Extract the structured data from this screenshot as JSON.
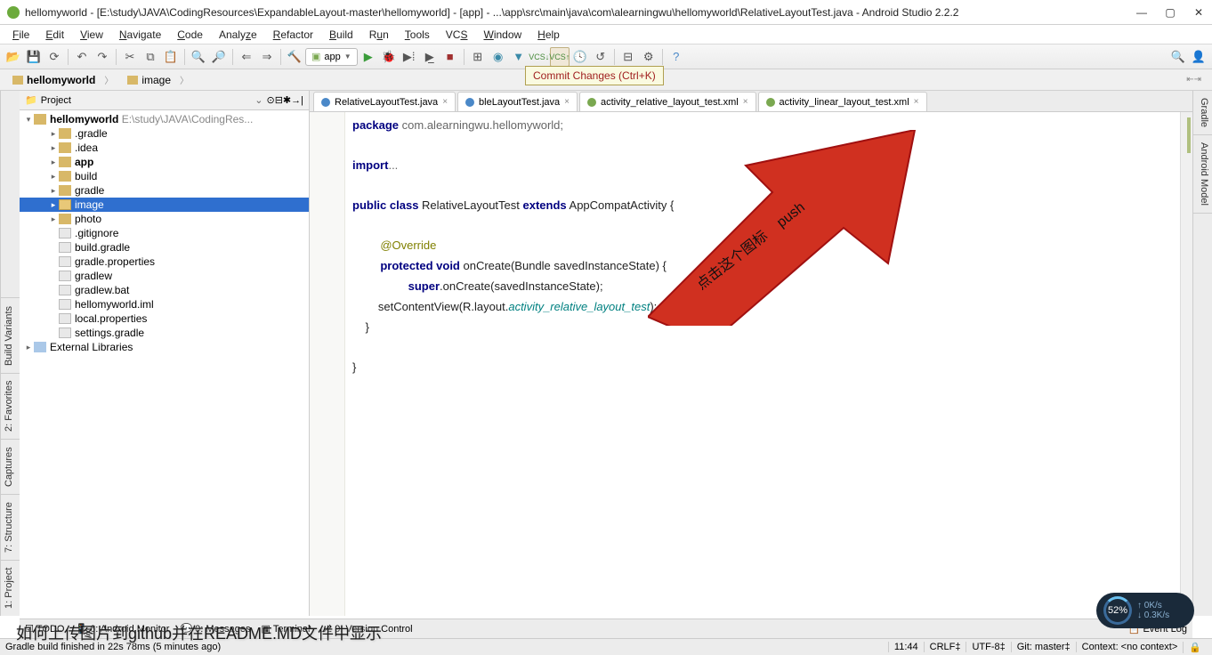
{
  "titlebar": {
    "title": "hellomyworld - [E:\\study\\JAVA\\CodingResources\\ExpandableLayout-master\\hellomyworld] - [app] - ...\\app\\src\\main\\java\\com\\alearningwu\\hellomyworld\\RelativeLayoutTest.java - Android Studio 2.2.2"
  },
  "menu": {
    "items": [
      "File",
      "Edit",
      "View",
      "Navigate",
      "Code",
      "Analyze",
      "Refactor",
      "Build",
      "Run",
      "Tools",
      "VCS",
      "Window",
      "Help"
    ]
  },
  "breadcrumbs": {
    "items": [
      "hellomyworld",
      "image"
    ]
  },
  "toolbar": {
    "config": "app",
    "tooltip": "Commit Changes (Ctrl+K)"
  },
  "leftRail": [
    "1: Project",
    "7: Structure",
    "Captures",
    "2: Favorites",
    "Build Variants"
  ],
  "rightRail": [
    "Gradle",
    "Android Model"
  ],
  "projectPanel": {
    "title": "Project"
  },
  "tree": {
    "root": {
      "label": "hellomyworld",
      "path": "E:\\study\\JAVA\\CodingRes..."
    },
    "items": [
      {
        "label": ".gradle",
        "depth": 1,
        "ico": "folder"
      },
      {
        "label": ".idea",
        "depth": 1,
        "ico": "folder"
      },
      {
        "label": "app",
        "depth": 1,
        "ico": "folder",
        "bold": true
      },
      {
        "label": "build",
        "depth": 1,
        "ico": "folder"
      },
      {
        "label": "gradle",
        "depth": 1,
        "ico": "folder"
      },
      {
        "label": "image",
        "depth": 1,
        "ico": "folder-o",
        "sel": true
      },
      {
        "label": "photo",
        "depth": 1,
        "ico": "folder"
      },
      {
        "label": ".gitignore",
        "depth": 1,
        "ico": "file"
      },
      {
        "label": "build.gradle",
        "depth": 1,
        "ico": "file"
      },
      {
        "label": "gradle.properties",
        "depth": 1,
        "ico": "file"
      },
      {
        "label": "gradlew",
        "depth": 1,
        "ico": "file"
      },
      {
        "label": "gradlew.bat",
        "depth": 1,
        "ico": "file"
      },
      {
        "label": "hellomyworld.iml",
        "depth": 1,
        "ico": "file"
      },
      {
        "label": "local.properties",
        "depth": 1,
        "ico": "file"
      },
      {
        "label": "settings.gradle",
        "depth": 1,
        "ico": "file"
      }
    ],
    "ext": "External Libraries"
  },
  "tabs": [
    {
      "label": "RelativeLayoutTest.java",
      "kind": "java"
    },
    {
      "label": "bleLayoutTest.java",
      "kind": "java"
    },
    {
      "label": "activity_relative_layout_test.xml",
      "kind": "xml"
    },
    {
      "label": "activity_linear_layout_test.xml",
      "kind": "xml"
    }
  ],
  "code": {
    "l1_kw": "package",
    "l1_rest": " com.alearningwu.hellomyworld;",
    "l3_kw": "import",
    "l3_rest": "...",
    "l5_kw1": "public class",
    "l5_cls": " RelativeLayoutTest ",
    "l5_kw2": "extends",
    "l5_sup": " AppCompatActivity {",
    "l7_ann": "@Override",
    "l8_kw": "protected void",
    "l8_sig": " onCreate(Bundle savedInstanceState) {",
    "l9_kw": "super",
    "l9_rest": ".onCreate(savedInstanceState);",
    "l10_a": "        setContentView(R.layout.",
    "l10_b": "activity_relative_layout_test",
    "l10_c": ");",
    "l11": "    }",
    "l13": "}"
  },
  "arrow": {
    "text1": "点击这个图标",
    "text2": "push"
  },
  "bottomTabs": {
    "items": [
      "TODO",
      "6: Android Monitor",
      "0: Messages",
      "Terminal",
      "9: Version Control"
    ],
    "right": "Event Log"
  },
  "statusbar": {
    "msg": "Gradle build finished in 22s 78ms (5 minutes ago)",
    "pos": "11:44",
    "sep": "CRLF‡",
    "enc": "UTF-8‡",
    "git": "Git: master‡",
    "ctx": "Context: <no context>"
  },
  "speed": {
    "pct": "52%",
    "up": "0K/s",
    "dn": "0.3K/s"
  },
  "caption": "如何上传图片到github并在README.MD文件中显示"
}
